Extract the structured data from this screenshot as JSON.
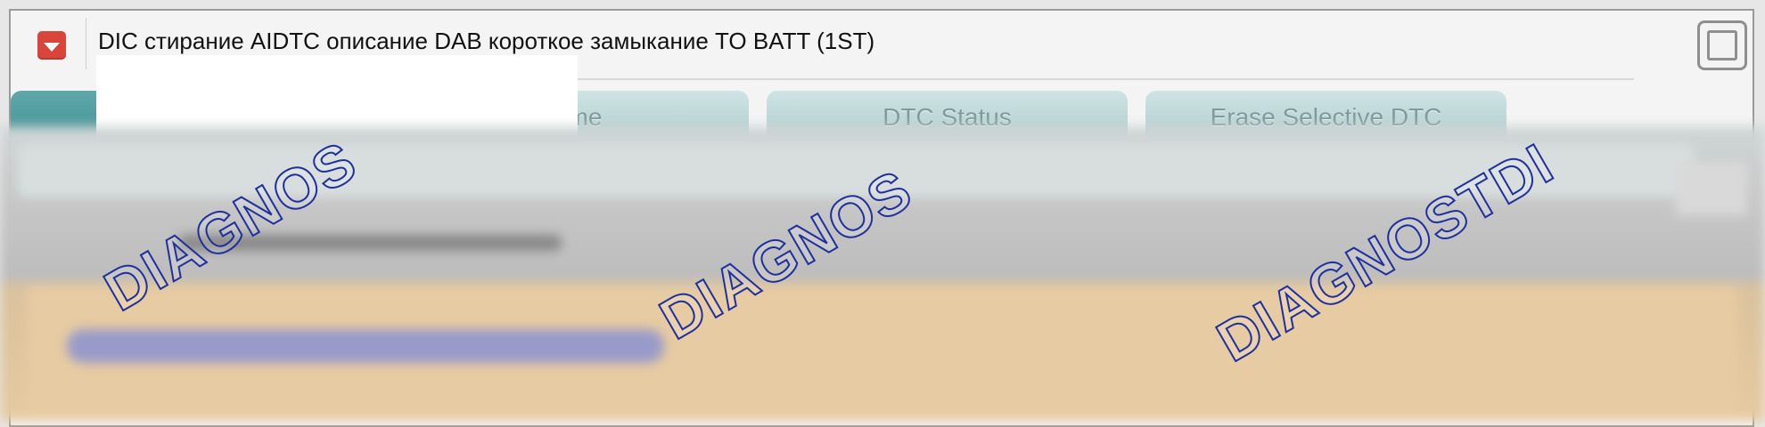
{
  "window": {
    "title": "DIC стирание AIDTC описание DAB короткое замыкание TO BATT (1ST)",
    "collapse_icon": "chevron-down-icon",
    "maximize_icon": "maximize-icon"
  },
  "tabs": [
    {
      "label": "",
      "active": true
    },
    {
      "label": "Frame",
      "active": false
    },
    {
      "label": "DTC Status",
      "active": false
    },
    {
      "label": "Erase Selective DTC",
      "active": false
    }
  ],
  "watermarks": [
    "DIAGNOS",
    "DIAGNOS",
    "DIAGNOSTDI"
  ],
  "colors": {
    "accent": "#d9443b",
    "tab_active": "#4f9b9e",
    "tab_inactive": "#bcd6d6",
    "watermark": "#1f2f9e"
  }
}
